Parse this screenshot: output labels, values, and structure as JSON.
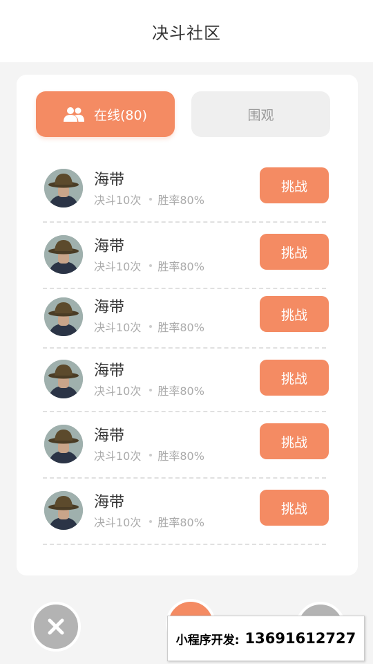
{
  "header": {
    "title": "决斗社区"
  },
  "tabs": {
    "online_label": "在线(80)",
    "watch_label": "围观"
  },
  "players": [
    {
      "name": "海带",
      "duels": "决斗10次",
      "win_rate": "胜率80%",
      "action": "挑战"
    },
    {
      "name": "海带",
      "duels": "决斗10次",
      "win_rate": "胜率80%",
      "action": "挑战"
    },
    {
      "name": "海带",
      "duels": "决斗10次",
      "win_rate": "胜率80%",
      "action": "挑战"
    },
    {
      "name": "海带",
      "duels": "决斗10次",
      "win_rate": "胜率80%",
      "action": "挑战"
    },
    {
      "name": "海带",
      "duels": "决斗10次",
      "win_rate": "胜率80%",
      "action": "挑战"
    },
    {
      "name": "海带",
      "duels": "决斗10次",
      "win_rate": "胜率80%",
      "action": "挑战"
    }
  ],
  "watermark": {
    "label": "小程序开发:",
    "phone": "13691612727"
  },
  "colors": {
    "accent": "#f48b63",
    "muted": "#b3b3b3",
    "background": "#f4f4f4"
  },
  "icons": {
    "tab_online": "users-icon",
    "close": "close-icon"
  }
}
